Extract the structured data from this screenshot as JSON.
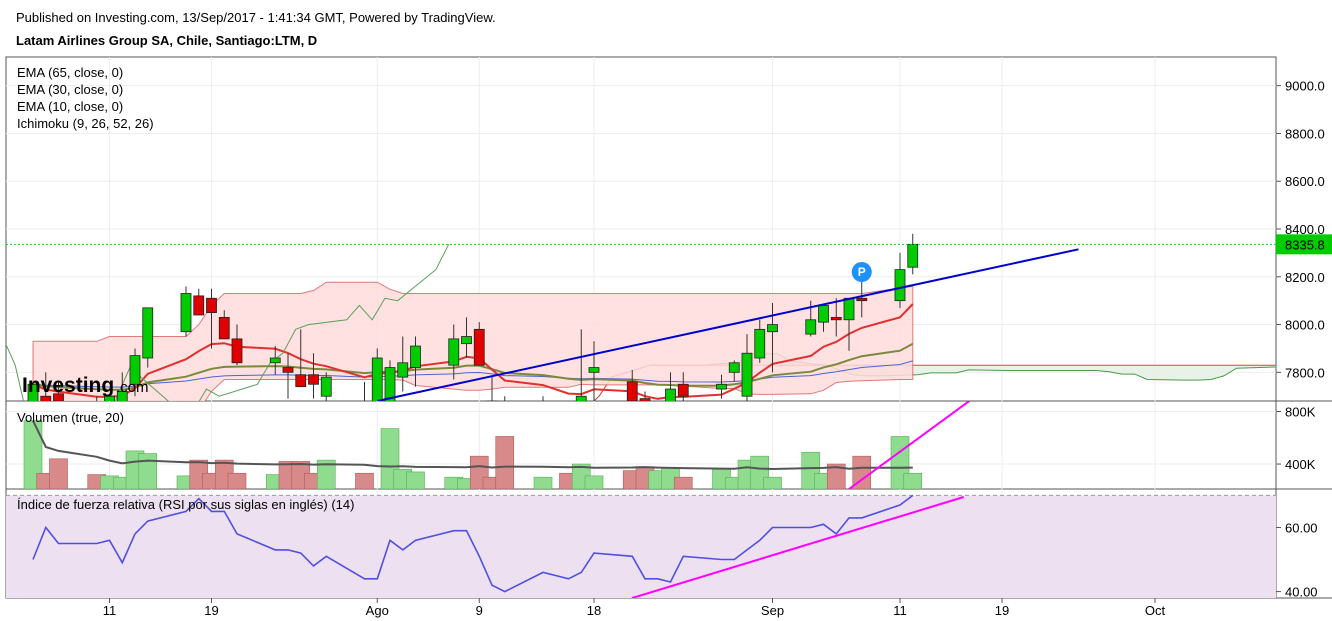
{
  "header": {
    "published": "Published on Investing.com, 13/Sep/2017 - 1:41:34 GMT, Powered by TradingView.",
    "instrument": "Latam Airlines Group SA, Chile, Santiago:LTM, D"
  },
  "logo": {
    "text": "Investing",
    "suffix": ".com"
  },
  "price_pane": {
    "legend": [
      "EMA (65, close, 0)",
      "EMA (30, close, 0)",
      "EMA (10, close, 0)",
      "Ichimoku (9, 26, 52, 26)"
    ],
    "y_ticks": [
      "9000.0",
      "8800.0",
      "8600.0",
      "8400.0",
      "8200.0",
      "8000.0",
      "7800.0"
    ],
    "last_price_label": "8335.8",
    "marker_label": "P"
  },
  "volume_pane": {
    "legend": "Volumen (true, 20)",
    "y_ticks": [
      "800K",
      "400K"
    ]
  },
  "rsi_pane": {
    "legend": "Índice de fuerza relativa (RSI por sus siglas en inglés) (14)",
    "y_ticks": [
      "60.00",
      "40.00"
    ]
  },
  "x_axis": {
    "ticks": [
      "11",
      "19",
      "Ago",
      "9",
      "18",
      "Sep",
      "11",
      "19",
      "Oct"
    ]
  },
  "colors": {
    "up": "#00cc00",
    "down": "#e00000",
    "trend": "#0000cc",
    "rsi": "#5050e0",
    "rsi_trend": "#ff00ff",
    "cloud": "#ffdcdc"
  },
  "chart_data": {
    "type": "candlestick",
    "price": {
      "dates": [
        "Jul-05",
        "Jul-06",
        "Jul-07",
        "Jul-10",
        "Jul-11",
        "Jul-12",
        "Jul-13",
        "Jul-14",
        "Jul-17",
        "Jul-18",
        "Jul-19",
        "Jul-20",
        "Jul-21",
        "Jul-24",
        "Jul-25",
        "Jul-26",
        "Jul-27",
        "Jul-28",
        "Jul-31",
        "Aug-01",
        "Aug-02",
        "Aug-03",
        "Aug-04",
        "Aug-07",
        "Aug-08",
        "Aug-09",
        "Aug-10",
        "Aug-11",
        "Aug-14",
        "Aug-16",
        "Aug-17",
        "Aug-18",
        "Aug-21",
        "Aug-22",
        "Aug-23",
        "Aug-24",
        "Aug-25",
        "Aug-28",
        "Aug-29",
        "Aug-30",
        "Aug-31",
        "Sep-01",
        "Sep-04",
        "Sep-05",
        "Sep-06",
        "Sep-07",
        "Sep-08",
        "Sep-11",
        "Sep-12"
      ],
      "open": [
        7600,
        7700,
        7710,
        7650,
        7600,
        7630,
        7750,
        7860,
        7970,
        8120,
        8110,
        8030,
        7940,
        7840,
        7820,
        7790,
        7790,
        7700,
        7650,
        7640,
        7600,
        7780,
        7820,
        7830,
        7920,
        7980,
        7680,
        7580,
        7620,
        7600,
        7580,
        7800,
        7760,
        7690,
        7610,
        7650,
        7750,
        7730,
        7800,
        7700,
        7860,
        7970,
        7960,
        8010,
        8030,
        8020,
        8110,
        8100,
        8240
      ],
      "high": [
        7760,
        7800,
        7760,
        7700,
        7700,
        7800,
        7900,
        8060,
        8160,
        8150,
        8150,
        8060,
        8000,
        7910,
        7880,
        7980,
        7880,
        7800,
        7760,
        7900,
        7850,
        7950,
        7950,
        8000,
        8030,
        8010,
        7780,
        7700,
        7700,
        7680,
        7980,
        7930,
        7810,
        7720,
        7650,
        7800,
        7800,
        7790,
        7850,
        7960,
        8020,
        8090,
        8100,
        8080,
        8110,
        8110,
        8260,
        8300,
        8380
      ],
      "low": [
        7500,
        7600,
        7650,
        7540,
        7500,
        7550,
        7700,
        7820,
        7950,
        8080,
        7900,
        7980,
        7830,
        7790,
        7690,
        7750,
        7690,
        7580,
        7500,
        7600,
        7580,
        7720,
        7740,
        7770,
        7860,
        7930,
        7640,
        7550,
        7540,
        7560,
        7560,
        7660,
        7660,
        7600,
        7590,
        7600,
        7650,
        7690,
        7760,
        7680,
        7840,
        7800,
        7950,
        7970,
        7950,
        7890,
        8030,
        8070,
        8210
      ],
      "close": [
        7750,
        7630,
        7680,
        7600,
        7700,
        7720,
        7870,
        8070,
        8130,
        8040,
        8050,
        7940,
        7840,
        7860,
        7800,
        7740,
        7750,
        7780,
        7570,
        7860,
        7820,
        7840,
        7910,
        7940,
        7950,
        7830,
        7600,
        7560,
        7660,
        7550,
        7700,
        7820,
        7680,
        7610,
        7640,
        7730,
        7700,
        7750,
        7840,
        7880,
        7980,
        8000,
        8020,
        8080,
        8020,
        8110,
        8100,
        8230,
        8335.8
      ]
    },
    "volume_k": [
      730,
      330,
      440,
      320,
      310,
      300,
      500,
      480,
      310,
      430,
      330,
      430,
      330,
      320,
      420,
      420,
      330,
      430,
      330,
      200,
      670,
      360,
      340,
      300,
      290,
      460,
      300,
      610,
      300,
      330,
      400,
      310,
      350,
      380,
      350,
      370,
      300,
      360,
      300,
      430,
      460,
      300,
      490,
      330,
      400,
      200,
      460,
      610,
      330
    ],
    "rsi": [
      50,
      60,
      55,
      55,
      56,
      49,
      58,
      62,
      65,
      69,
      65,
      65,
      58,
      53,
      53,
      52,
      48,
      51,
      44,
      44,
      56,
      53,
      56,
      59,
      59,
      51,
      42,
      40,
      46,
      44,
      46,
      52,
      51,
      44,
      44,
      43,
      51,
      50,
      50,
      53,
      56,
      60,
      60,
      61,
      58,
      63,
      63,
      67,
      70
    ],
    "x_range": [
      "Jul-05",
      "Oct-05"
    ],
    "price_ylim": [
      7680,
      9120
    ],
    "volume_ylim_k": [
      210,
      880
    ],
    "rsi_ylim": [
      38,
      72
    ],
    "last_price": 8335.8
  }
}
